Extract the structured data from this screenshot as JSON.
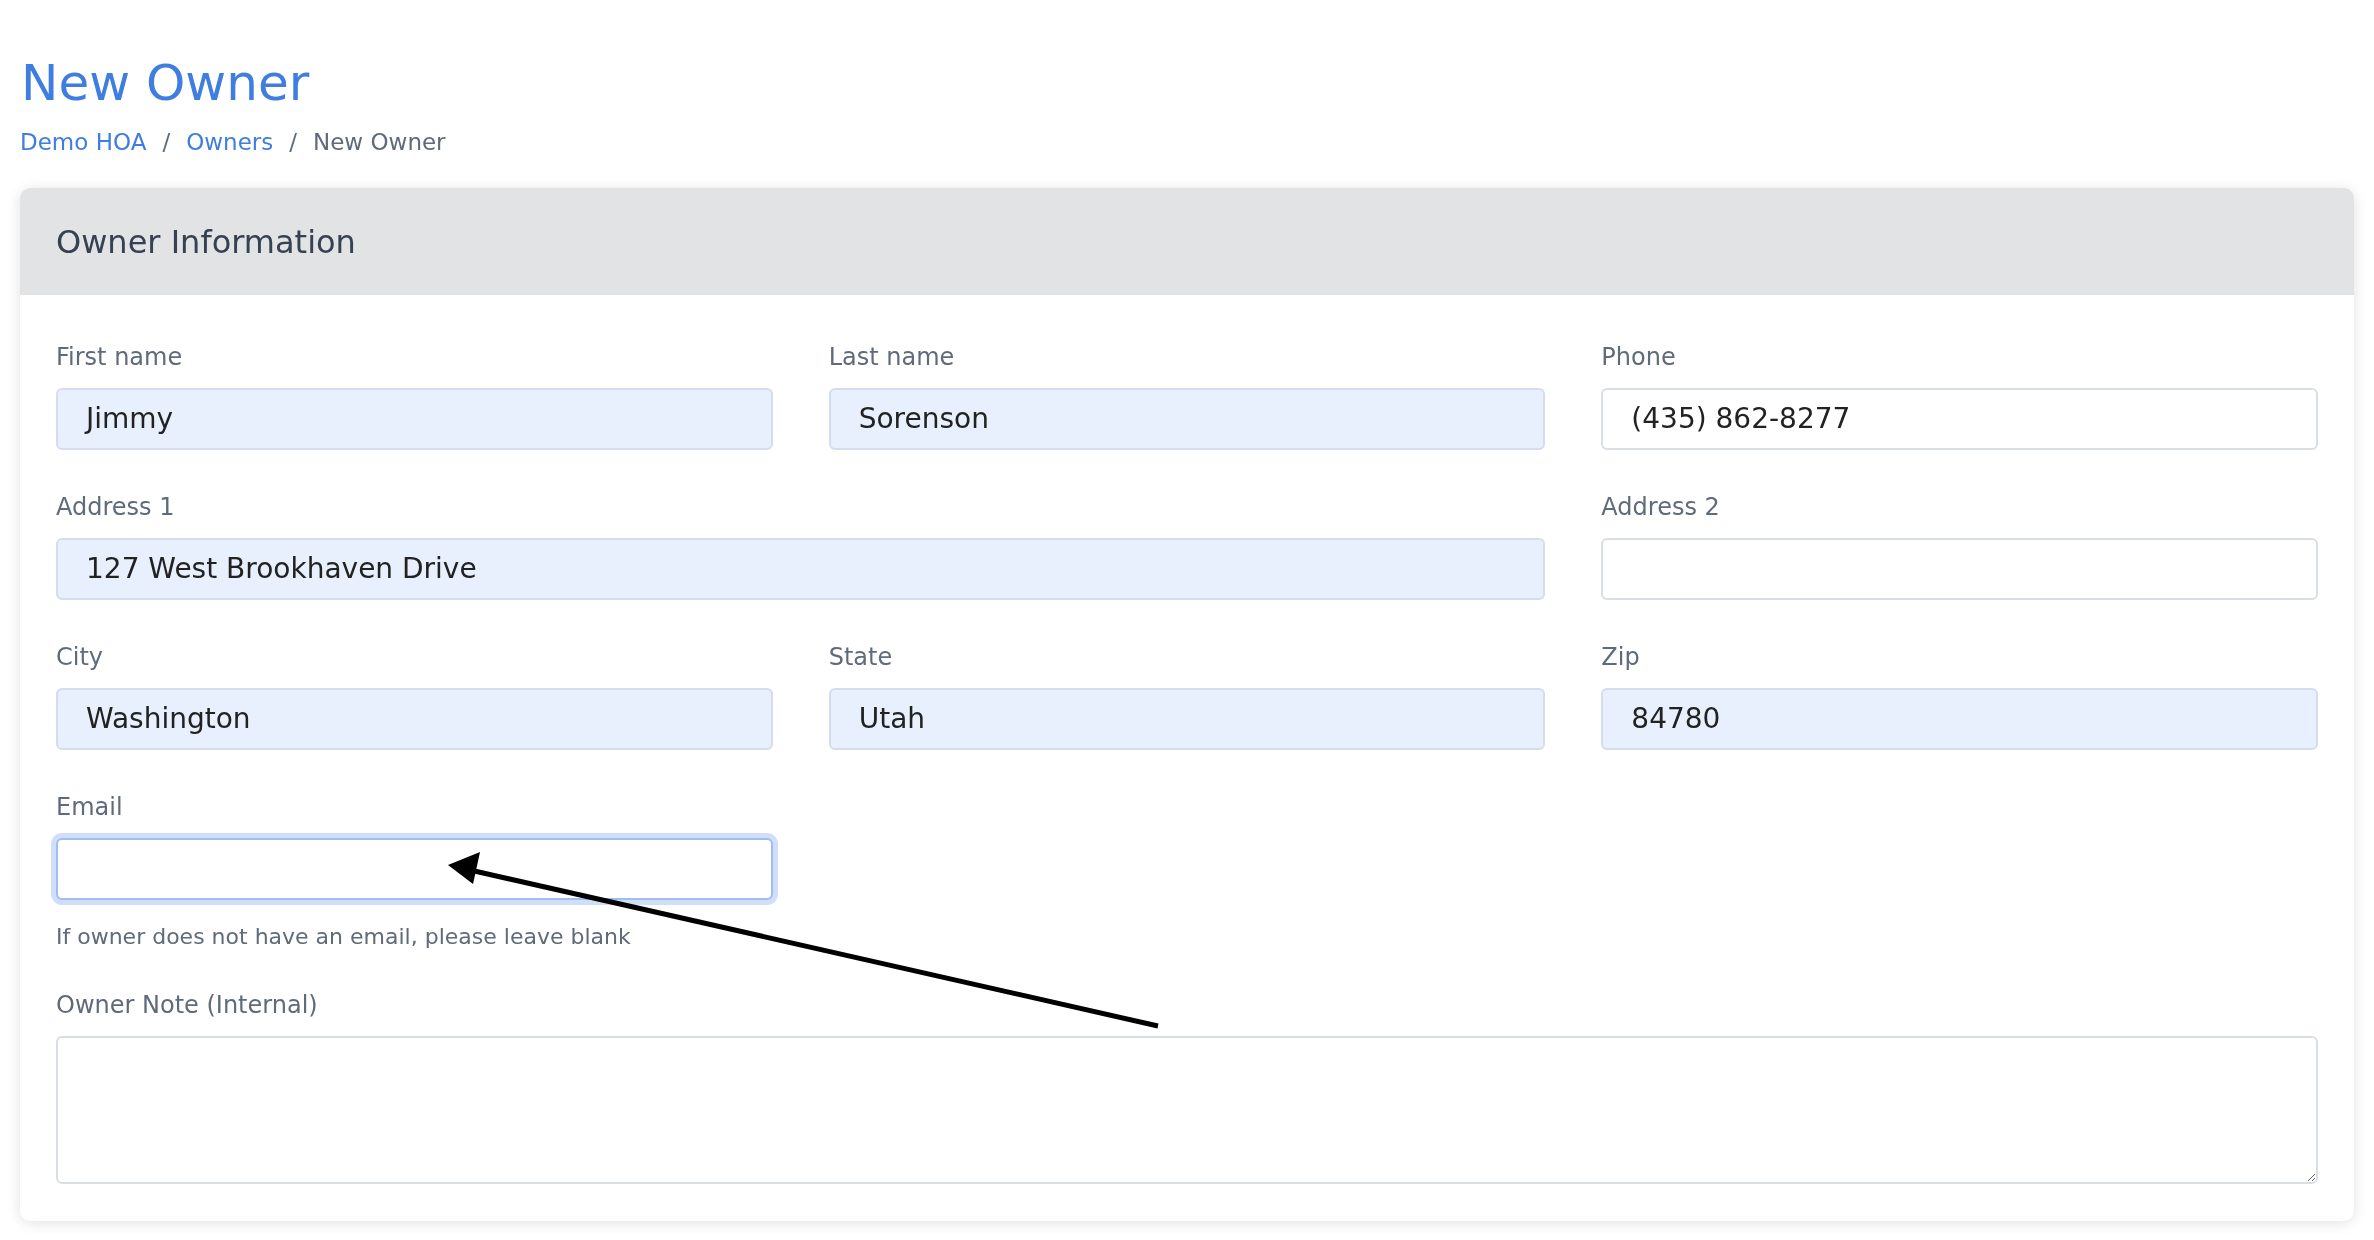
{
  "page": {
    "title": "New Owner"
  },
  "breadcrumb": {
    "separator": "/",
    "items": [
      {
        "label": "Demo HOA",
        "link": true
      },
      {
        "label": "Owners",
        "link": true
      },
      {
        "label": "New Owner",
        "link": false
      }
    ]
  },
  "card": {
    "title": "Owner Information",
    "rows": [
      [
        {
          "label": "First name",
          "value": "Jimmy",
          "autofilled": true,
          "focused": false
        },
        {
          "label": "Last name",
          "value": "Sorenson",
          "autofilled": true,
          "focused": false
        },
        {
          "label": "Phone",
          "value": "(435) 862-8277",
          "autofilled": false,
          "focused": false
        }
      ],
      [
        {
          "label": "Address 1",
          "value": "127 West Brookhaven Drive",
          "autofilled": true,
          "focused": false,
          "colspan": 2
        },
        {
          "label": "Address 2",
          "autofilled": false,
          "focused": false
        }
      ],
      [
        {
          "label": "City",
          "value": "Washington",
          "autofilled": true,
          "focused": false
        },
        {
          "label": "State",
          "value": "Utah",
          "autofilled": true,
          "focused": false
        },
        {
          "label": "Zip",
          "value": "84780",
          "autofilled": true,
          "focused": false
        }
      ],
      [
        {
          "label": "Email",
          "autofilled": false,
          "focused": true,
          "help": "If owner does not have an email, please leave blank"
        }
      ]
    ],
    "note": {
      "label": "Owner Note (Internal)"
    }
  }
}
